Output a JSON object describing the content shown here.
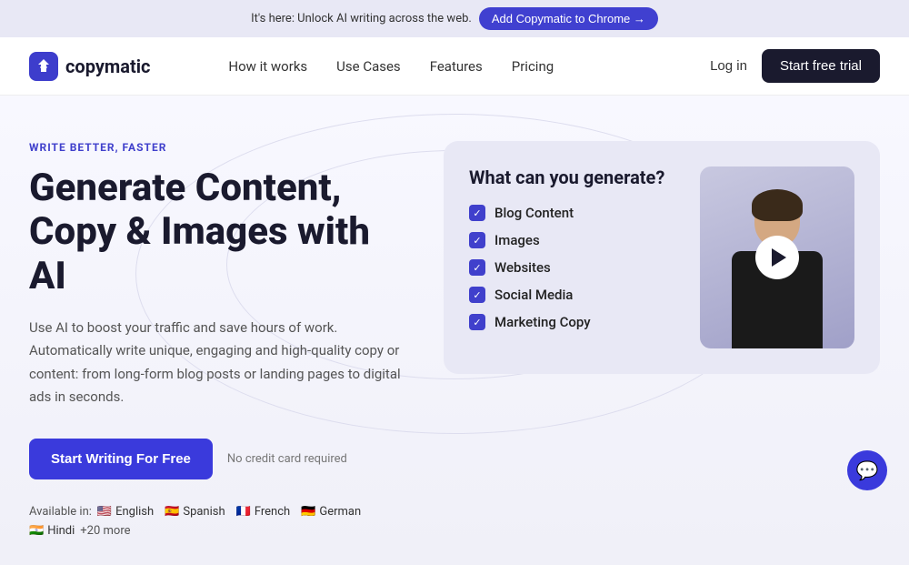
{
  "banner": {
    "text": "It's here: Unlock AI writing across the web.",
    "cta_label": "Add Copymatic to Chrome →"
  },
  "nav": {
    "logo_text": "copymatic",
    "links": [
      {
        "label": "How it works",
        "id": "how-it-works"
      },
      {
        "label": "Use Cases",
        "id": "use-cases"
      },
      {
        "label": "Features",
        "id": "features"
      },
      {
        "label": "Pricing",
        "id": "pricing"
      }
    ],
    "login_label": "Log in",
    "trial_label": "Start free trial"
  },
  "hero": {
    "eyebrow": "WRITE BETTER, FASTER",
    "title_line1": "Generate Content,",
    "title_line2": "Copy & Images with AI",
    "description": "Use AI to boost your traffic and save hours of work. Automatically write unique, engaging and high-quality copy or content: from long-form blog posts or landing pages to digital ads in seconds.",
    "cta_label": "Start Writing For Free",
    "no_cc": "No credit card required"
  },
  "available_in": {
    "label": "Available in:",
    "languages": [
      {
        "flag": "🇺🇸",
        "name": "English"
      },
      {
        "flag": "🇪🇸",
        "name": "Spanish"
      },
      {
        "flag": "🇫🇷",
        "name": "French"
      },
      {
        "flag": "🇩🇪",
        "name": "German"
      },
      {
        "flag": "🇮🇳",
        "name": "Hindi"
      },
      {
        "more": "+20 more"
      }
    ]
  },
  "card": {
    "title": "What can you generate?",
    "items": [
      "Blog Content",
      "Images",
      "Websites",
      "Social Media",
      "Marketing Copy"
    ]
  },
  "chat": {
    "icon": "💬"
  },
  "colors": {
    "brand": "#3a3adc",
    "dark": "#1a1a2e"
  }
}
